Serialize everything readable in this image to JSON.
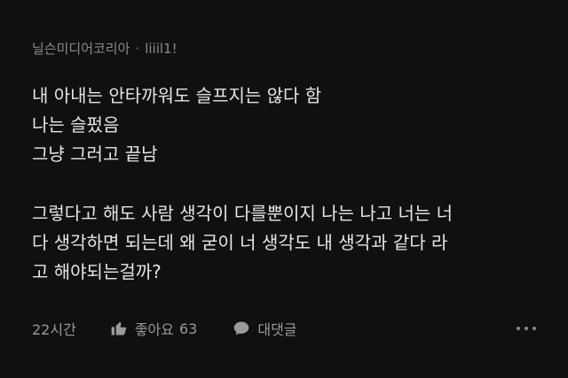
{
  "comment": {
    "author": "닐슨미디어코리아",
    "separator": "·",
    "author_tag": "liiil1!",
    "body_lines_block1": [
      "내 아내는 안타까워도 슬프지는 않다 함",
      "나는 슬펐음",
      "그냥 그러고 끝남"
    ],
    "body_lines_block2": [
      "그렇다고 해도 사람 생각이 다를뿐이지 나는 나고 너는 너",
      "다 생각하면 되는데 왜 굳이 너 생각도 내 생각과 같다 라",
      "고 해야되는걸까?"
    ],
    "timestamp": "22시간",
    "like_label": "좋아요",
    "like_count": "63",
    "reply_label": "대댓글"
  },
  "colors": {
    "background": "#101010",
    "text_primary": "#e6e6e6",
    "text_secondary": "#8a8a8a"
  },
  "icons": {
    "like": "thumbs-up-icon",
    "reply": "speech-bubble-icon",
    "more": "more-dots-icon"
  }
}
